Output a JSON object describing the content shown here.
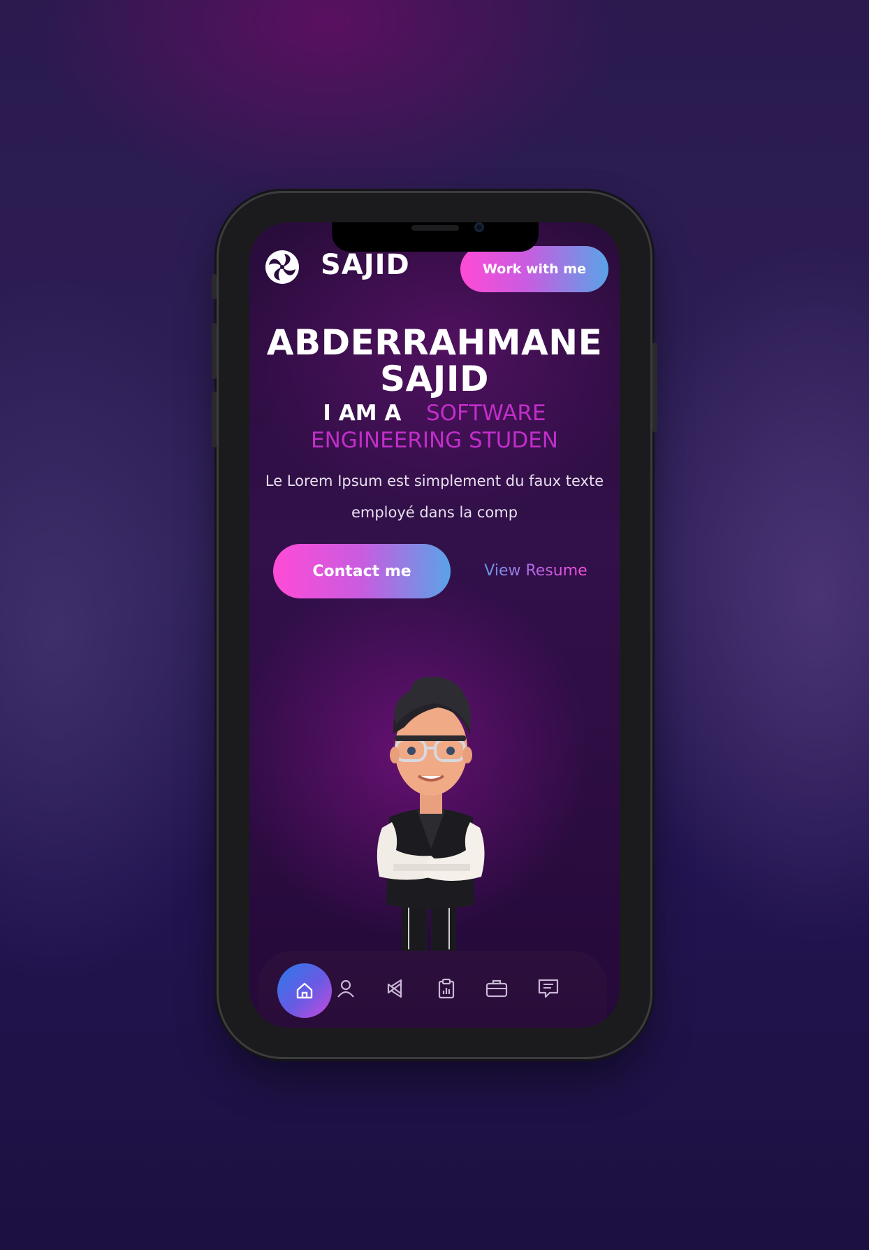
{
  "header": {
    "brand": "SAJID",
    "cta_label": "Work with me"
  },
  "hero": {
    "name": "ABDERRAHMANE SAJID",
    "role_prefix": "I AM A",
    "role_highlight": "SOFTWARE ENGINEERING STUDEN",
    "description": "Le Lorem Ipsum est simplement du faux texte employé dans la comp",
    "contact_label": "Contact me",
    "resume_label": "View Resume"
  },
  "nav": {
    "items": [
      {
        "icon": "home-icon",
        "active": true
      },
      {
        "icon": "user-icon",
        "active": false
      },
      {
        "icon": "code-icon",
        "active": false
      },
      {
        "icon": "clipboard-chart-icon",
        "active": false
      },
      {
        "icon": "briefcase-icon",
        "active": false
      },
      {
        "icon": "chat-icon",
        "active": false
      }
    ]
  },
  "colors": {
    "accent_pink": "#ff4bd6",
    "accent_blue": "#5aa3e8",
    "highlight_text": "#c12ec8"
  }
}
